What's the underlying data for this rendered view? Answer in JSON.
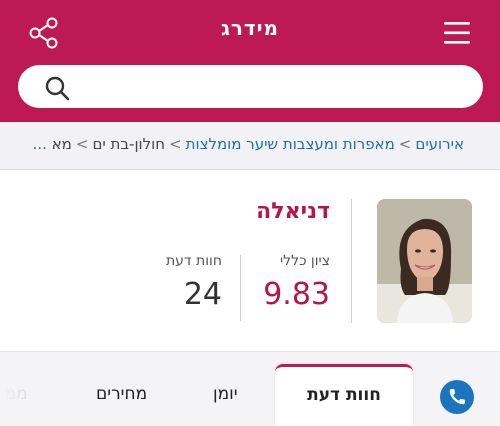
{
  "header": {
    "logo_text": "מידרג",
    "share_icon": "share-icon",
    "menu_icon": "hamburger-menu-icon",
    "brand_color": "#bd1a54"
  },
  "search": {
    "placeholder": "",
    "value": "",
    "icon": "search-icon"
  },
  "breadcrumb": {
    "items": [
      "אירועים",
      "מאפרות ומעצבות שיער מומלצות"
    ],
    "current": "חולון-בת ים",
    "tail": "מא",
    "ellipsis": "...",
    "separator": ">"
  },
  "profile": {
    "name": "דניאלה",
    "score_label": "ציון כללי",
    "score_value": "9.83",
    "reviews_label": "חוות דעת",
    "reviews_value": "24"
  },
  "tabs": {
    "items": [
      "חוות דעת",
      "יומן",
      "מחירים",
      "ממו"
    ],
    "active_index": 0,
    "call_icon": "phone-icon"
  }
}
